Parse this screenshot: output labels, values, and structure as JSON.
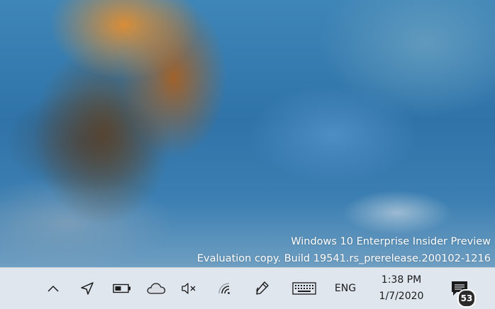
{
  "desktop": {
    "watermark": {
      "line1": "Windows 10 Enterprise Insider Preview",
      "line2": "Evaluation copy. Build 19541.rs_prerelease.200102-1216"
    }
  },
  "taskbar": {
    "tray_icons": [
      {
        "name": "show-hidden-icons",
        "icon": "chevron-up-icon"
      },
      {
        "name": "location",
        "icon": "location-arrow-icon"
      },
      {
        "name": "battery",
        "icon": "battery-icon"
      },
      {
        "name": "onedrive",
        "icon": "cloud-icon"
      },
      {
        "name": "volume-muted",
        "icon": "speaker-mute-icon"
      },
      {
        "name": "network",
        "icon": "wifi-icon"
      },
      {
        "name": "pen-workspace",
        "icon": "pen-icon"
      },
      {
        "name": "touch-keyboard",
        "icon": "keyboard-icon"
      }
    ],
    "language": "ENG",
    "clock": {
      "time": "1:38 PM",
      "date": "1/7/2020"
    },
    "action_center": {
      "icon": "notification-icon",
      "badge_count": "53"
    }
  },
  "colors": {
    "taskbar_bg": "#dfe6ee",
    "badge_bg": "#2b2b2b",
    "watermark_text": "#ffffff"
  }
}
